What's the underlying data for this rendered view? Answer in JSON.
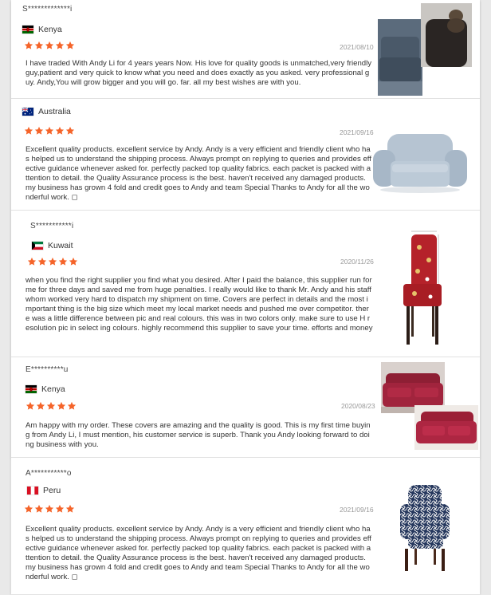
{
  "reviews": [
    {
      "username": "S*************i",
      "country": "Kenya",
      "flag": "kenya",
      "rating": 5,
      "date": "2021/08/10",
      "text": "I have traded With Andy Li for 4 years years Now. His love for quality goods is unmatched,very friendly guy,patient and very quick to know what you need and does exactly as you asked. very professional guy. Andy,You will grow bigger and you will go. far. all my best wishes are with you."
    },
    {
      "username": "",
      "country": "Australia",
      "flag": "australia",
      "rating": 5,
      "date": "2021/09/16",
      "text": "Excellent quality products. excellent service by Andy. Andy is a very efficient and friendly client who has helped us to understand the shipping process. Always prompt on replying to queries and provides effective guidance whenever asked for. perfectly packed top quality fabrics. each packet is packed with attention to detail. the Quality Assurance process is the best. haven't received any damaged products. my business has grown 4 fold and credit goes to Andy and team Special Thanks to Andy for all the wonderful work. ◻"
    },
    {
      "username": "S***********i",
      "country": "Kuwait",
      "flag": "kuwait",
      "rating": 5,
      "date": "2020/11/26",
      "text": "when you find the right supplier you find what you desired. After I paid the balance, this supplier run for me for three days and saved me from huge penalties. I really would like to thank Mr. Andy and his staff whom worked very hard to dispatch my shipment on time. Covers are perfect in details and the most important thing is the big size which meet my local market needs and pushed me over competitor. there was a little difference between pic and real colours. this was in two colors only. make sure to use H resolution pic in select ing colours. highly recommend this supplier to save your time. efforts and money"
    },
    {
      "username": "E**********u",
      "country": "Kenya",
      "flag": "kenya",
      "rating": 5,
      "date": "2020/08/23",
      "text": "Am happy with my order. These covers are amazing and the quality is good. This is my first time buying from Andy Li, I must mention, his customer service is superb. Thank you Andy looking forward to doing business with you."
    },
    {
      "username": "A***********o",
      "country": "Peru",
      "flag": "peru",
      "rating": 5,
      "date": "2021/09/16",
      "text": "Excellent quality products. excellent service by Andy. Andy is a very efficient and friendly client who has helped us to understand the shipping process. Always prompt on replying to queries and provides effective guidance whenever asked for. perfectly packed top quality fabrics. each packet is packed with attention to detail. the Quality Assurance process is the best. haven't received any damaged products. my business has grown 4 fold and credit goes to Andy and team Special Thanks to Andy for all the wonderful work. ◻"
    }
  ],
  "colors": {
    "star": "#f5642a",
    "date": "#999999",
    "text": "#333333"
  }
}
